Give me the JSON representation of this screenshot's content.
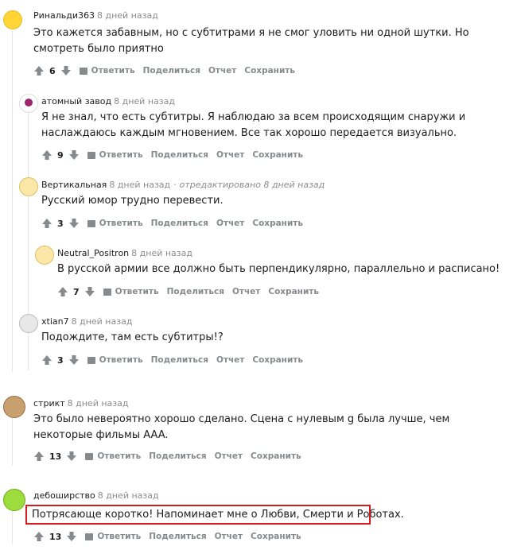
{
  "action_labels": {
    "reply": "Ответить",
    "share": "Поделиться",
    "report": "Отчет",
    "save": "Сохранить"
  },
  "comments": [
    {
      "author": "Ринальди363",
      "time": "8 дней назад",
      "edited": "",
      "text": "Это кажется забавным, но с субтитрами я не смог уловить ни одной шутки. Но смотреть было приятно",
      "votes": "6"
    },
    {
      "author": "атомный завод",
      "time": "8 дней назад",
      "edited": "",
      "text": "Я не знал, что есть субтитры. Я наблюдаю за всем происходящим снаружи и наслаждаюсь каждым мгновением. Все так хорошо передается визуально.",
      "votes": "9"
    },
    {
      "author": "Вертикальная",
      "time": "8 дней назад",
      "edited": "отредактировано 8 дней назад",
      "text": "Русский юмор трудно перевести.",
      "votes": "3"
    },
    {
      "author": "Neutral_Positron",
      "time": "8 дней назад",
      "edited": "",
      "text": "В русской армии все должно быть перпендикулярно, параллельно и расписано!",
      "votes": "7"
    },
    {
      "author": "xtian7",
      "time": "8 дней назад",
      "edited": "",
      "text": "Подождите, там есть субтитры!?",
      "votes": "3"
    },
    {
      "author": "стрикт",
      "time": "8 дней назад",
      "edited": "",
      "text": "Это было невероятно хорошо сделано. Сцена с нулевым g была лучше, чем некоторые фильмы AAA.",
      "votes": "13"
    },
    {
      "author": "дебоширство",
      "time": "8 дней назад",
      "edited": "",
      "text": "Потрясающе коротко! Напоминает мне о Любви, Смерти и Роботах.",
      "votes": "13"
    }
  ]
}
